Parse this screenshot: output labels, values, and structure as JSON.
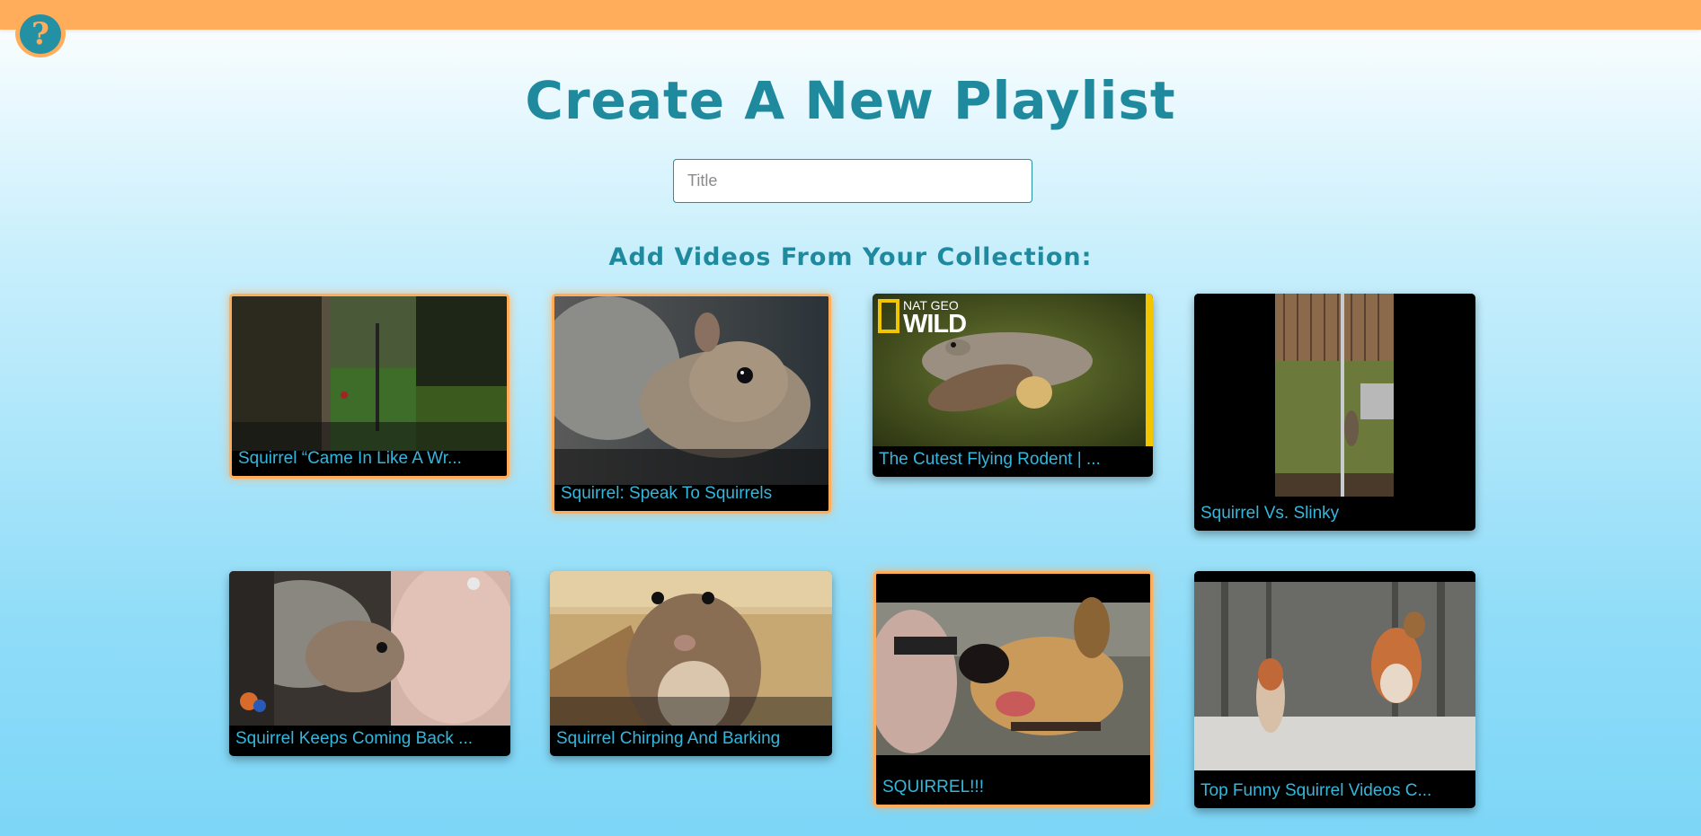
{
  "header": {
    "logo_icon": "question-mark-logo-icon",
    "logo_glyph": "?"
  },
  "page": {
    "title": "Create A New Playlist",
    "title_input": {
      "placeholder": "Title",
      "value": ""
    },
    "subtitle": "Add Videos From Your Collection:"
  },
  "colors": {
    "accent_orange": "#ffad5a",
    "brand_teal": "#2390a3",
    "video_title_blue": "#33b7dd"
  },
  "videos": [
    {
      "title": "Squirrel “Came In Like A Wr...",
      "selected": true
    },
    {
      "title": "Squirrel: Speak To Squirrels",
      "selected": true
    },
    {
      "title": "The Cutest Flying Rodent | ...",
      "selected": false,
      "brand_text_top": "NAT GEO",
      "brand_text_bottom": "WILD"
    },
    {
      "title": "Squirrel Vs. Slinky",
      "selected": false
    },
    {
      "title": "Squirrel Keeps Coming Back ...",
      "selected": false
    },
    {
      "title": "Squirrel Chirping And Barking",
      "selected": false
    },
    {
      "title": "SQUIRREL!!!",
      "selected": true
    },
    {
      "title": "Top Funny Squirrel Videos C...",
      "selected": false
    }
  ]
}
